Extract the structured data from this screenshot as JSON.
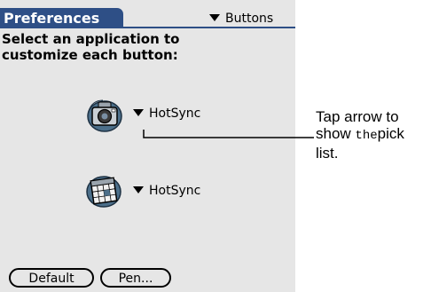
{
  "header": {
    "title": "Preferences",
    "panel_selector": "Buttons"
  },
  "instruction": {
    "line1": "Select an application to",
    "line2": "customize each button:"
  },
  "button_rows": [
    {
      "icon": "camera-icon",
      "app": "HotSync"
    },
    {
      "icon": "date-book-icon",
      "app": "HotSync"
    }
  ],
  "footer": {
    "default_label": "Default",
    "pen_label": "Pen..."
  },
  "callout": {
    "line1": "Tap arrow to",
    "line2_a": "show ",
    "line2_b": "the",
    "line2_c": "pick",
    "line3": "list."
  },
  "colors": {
    "title_bar": "#2e4f86",
    "screen_bg": "#e6e6e6",
    "page_bg": "#ffffff"
  }
}
